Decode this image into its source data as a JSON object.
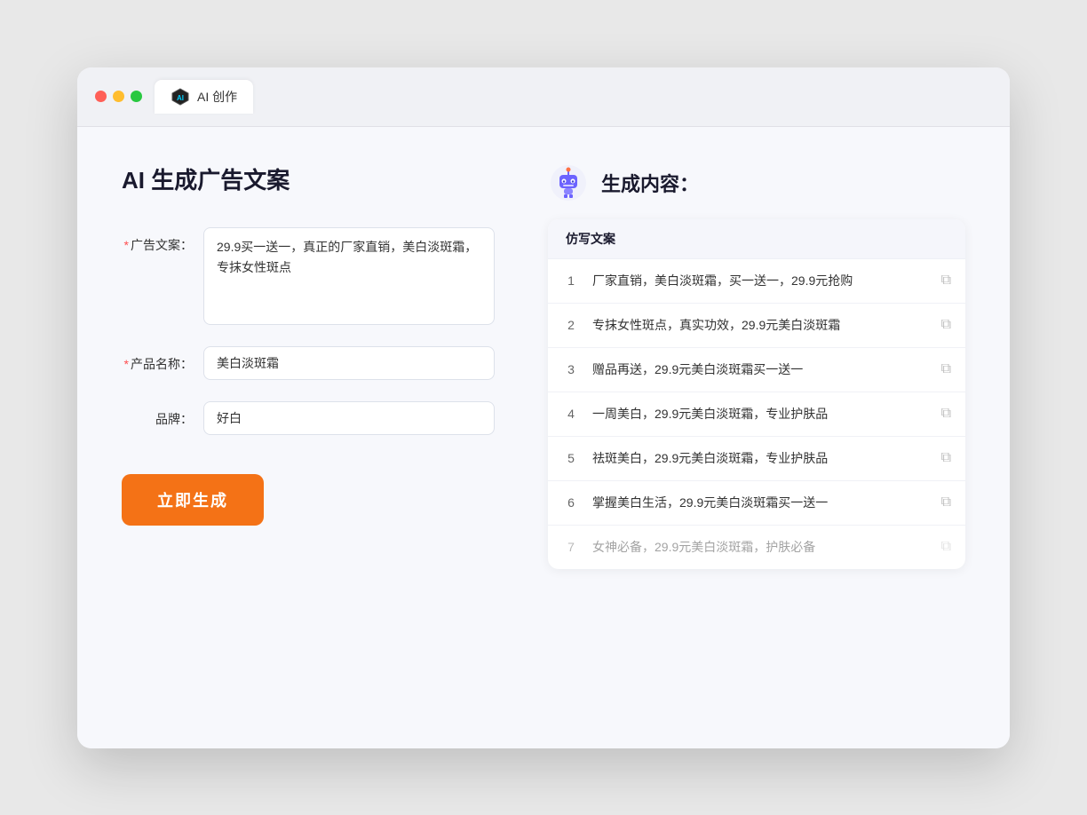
{
  "window": {
    "tab_label": "AI 创作"
  },
  "page": {
    "title": "AI 生成广告文案",
    "result_title": "生成内容："
  },
  "form": {
    "ad_copy_label": "广告文案：",
    "ad_copy_required": "*",
    "ad_copy_value": "29.9买一送一，真正的厂家直销，美白淡斑霜，专抹女性斑点",
    "product_name_label": "产品名称：",
    "product_name_required": "*",
    "product_name_value": "美白淡斑霜",
    "brand_label": "品牌：",
    "brand_value": "好白",
    "generate_button": "立即生成"
  },
  "results": {
    "table_header": "仿写文案",
    "items": [
      {
        "id": 1,
        "text": "厂家直销，美白淡斑霜，买一送一，29.9元抢购"
      },
      {
        "id": 2,
        "text": "专抹女性斑点，真实功效，29.9元美白淡斑霜"
      },
      {
        "id": 3,
        "text": "赠品再送，29.9元美白淡斑霜买一送一"
      },
      {
        "id": 4,
        "text": "一周美白，29.9元美白淡斑霜，专业护肤品"
      },
      {
        "id": 5,
        "text": "祛斑美白，29.9元美白淡斑霜，专业护肤品"
      },
      {
        "id": 6,
        "text": "掌握美白生活，29.9元美白淡斑霜买一送一"
      },
      {
        "id": 7,
        "text": "女神必备，29.9元美白淡斑霜，护肤必备"
      }
    ]
  }
}
